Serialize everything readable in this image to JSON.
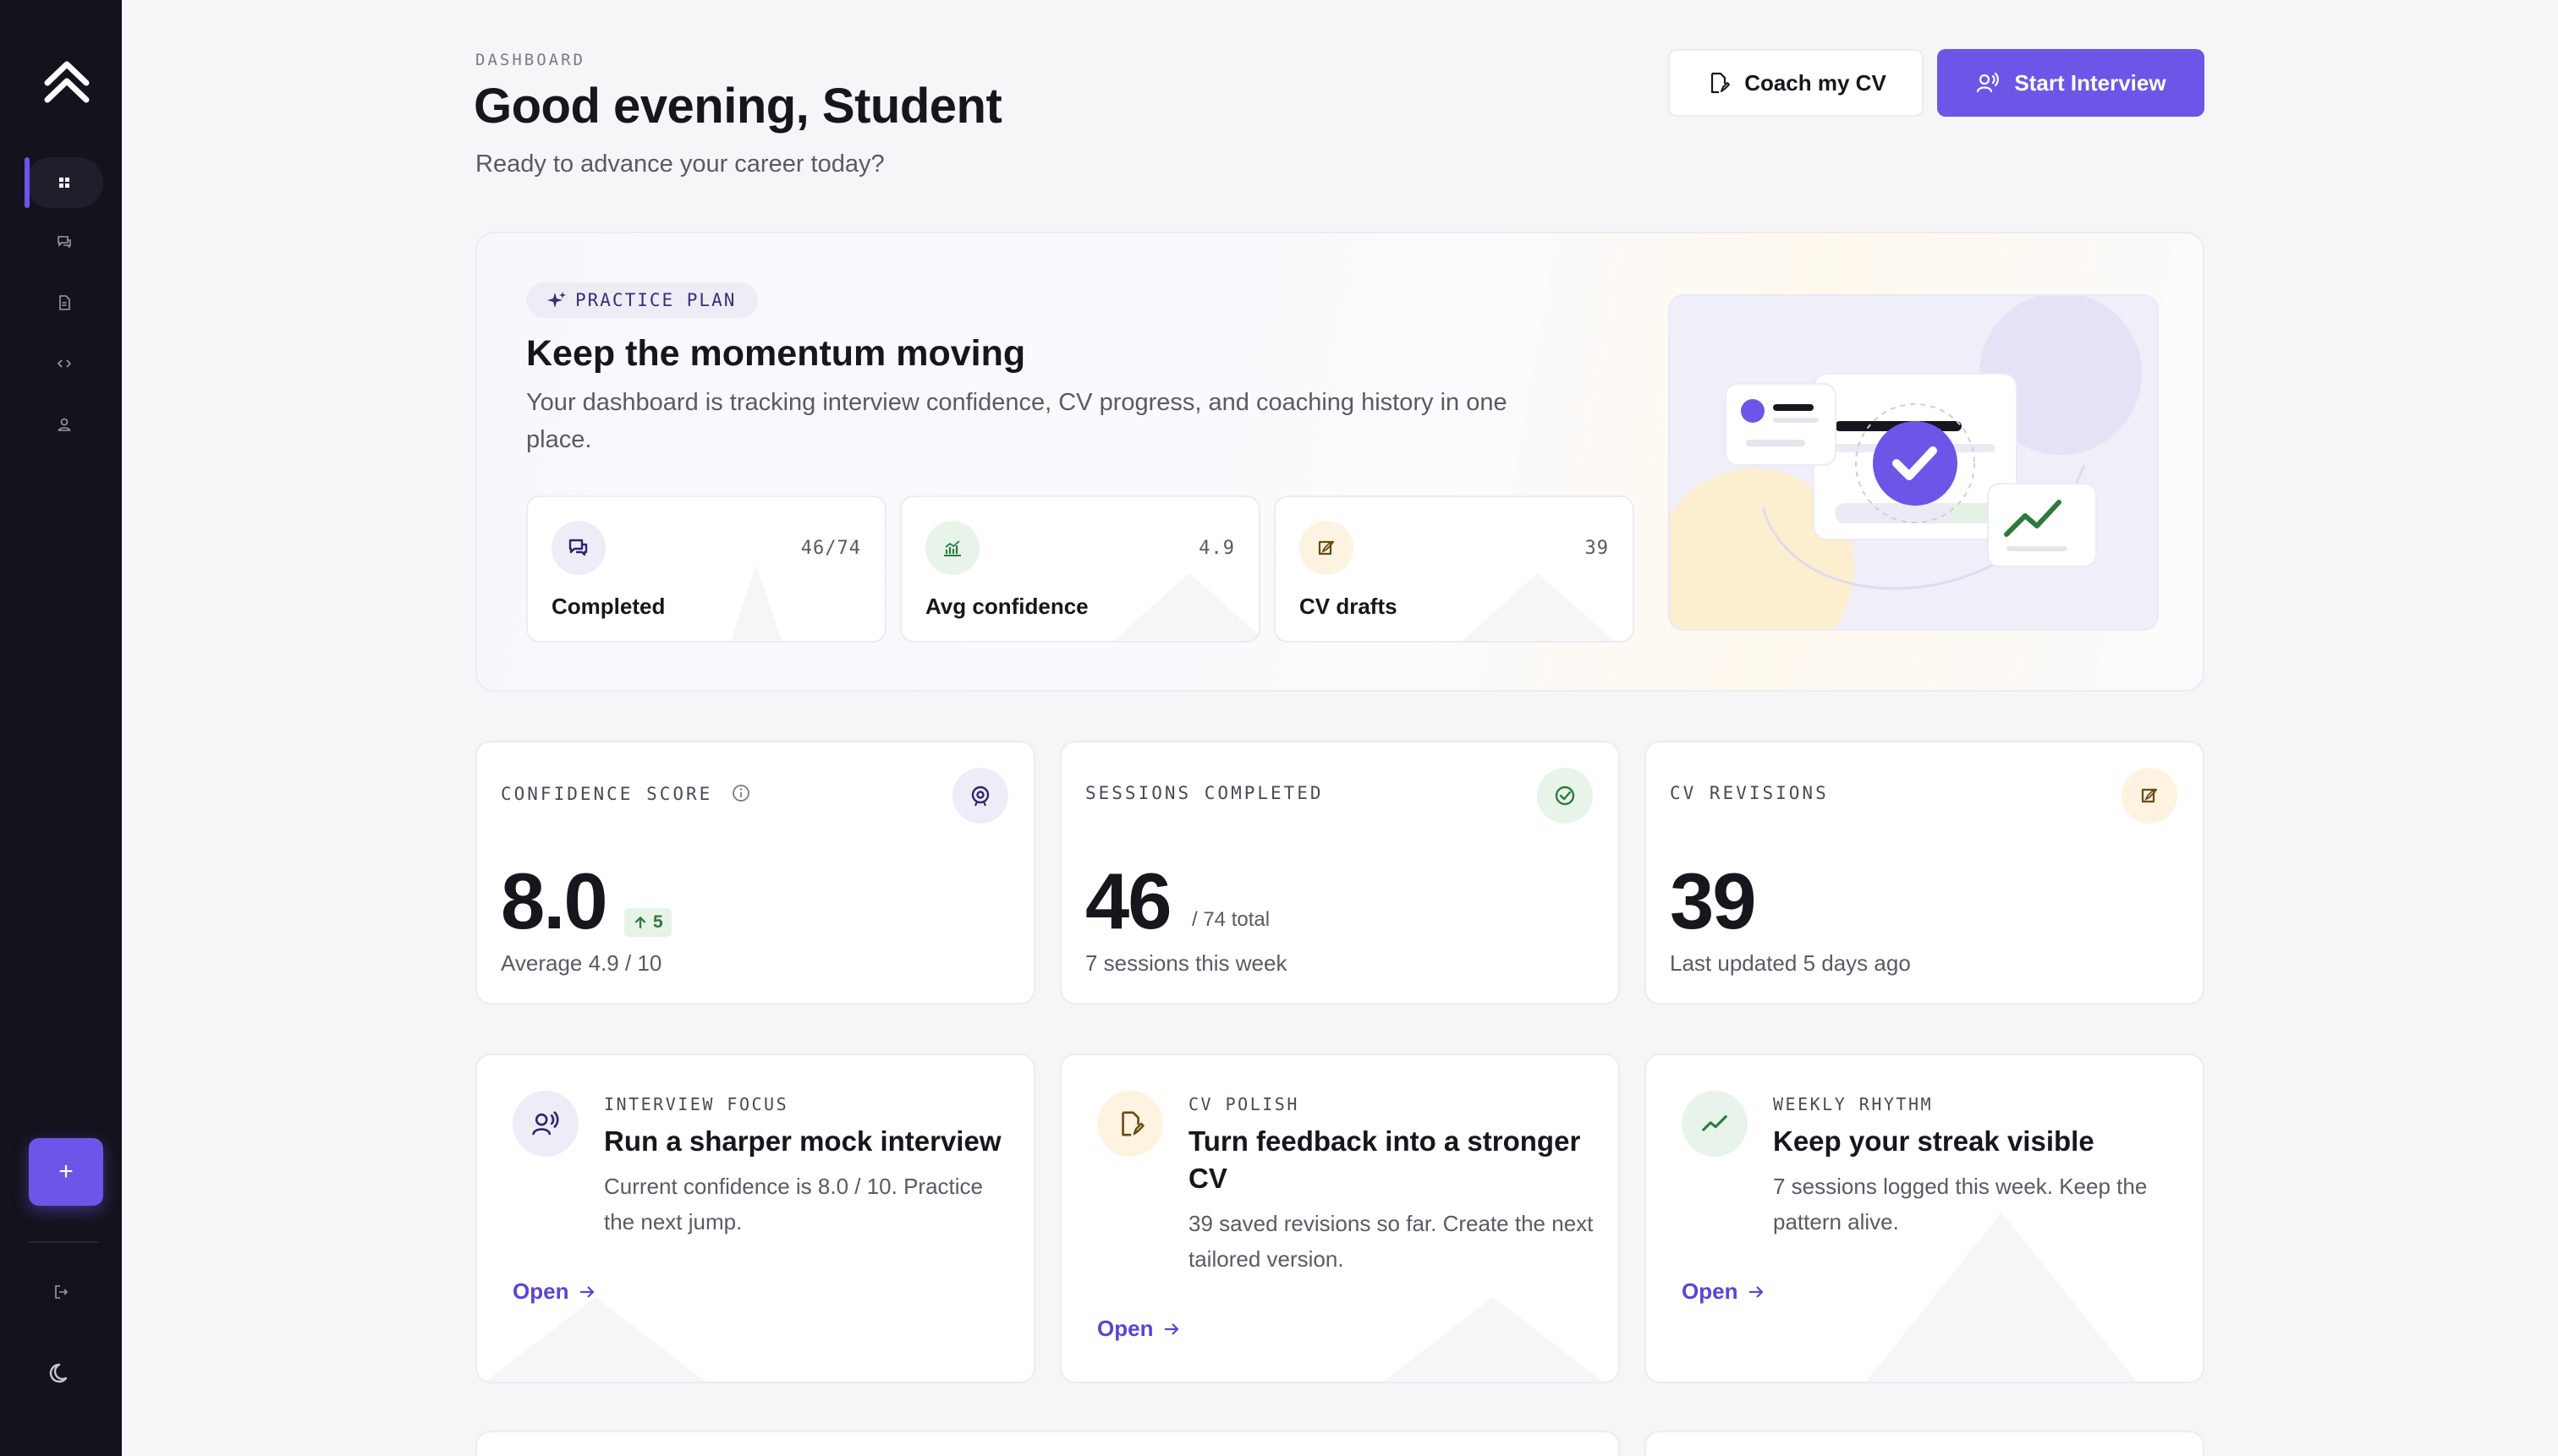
{
  "colors": {
    "accent": "#6c56e8",
    "sidebar_bg": "#13131d",
    "success": "#2d7a3c",
    "warning_bg": "#fdf3e0"
  },
  "sidebar": {
    "items": [
      {
        "name": "dashboard",
        "icon": "grid-icon",
        "active": true
      },
      {
        "name": "interviews",
        "icon": "chat-icon",
        "active": false
      },
      {
        "name": "cv",
        "icon": "document-icon",
        "active": false
      },
      {
        "name": "code",
        "icon": "code-icon",
        "active": false
      },
      {
        "name": "profile",
        "icon": "user-icon",
        "active": false
      }
    ],
    "plus_label": "+"
  },
  "header": {
    "eyebrow": "DASHBOARD",
    "title": "Good evening, Student",
    "subtitle": "Ready to advance your career today?",
    "coach_label": "Coach my CV",
    "start_label": "Start Interview"
  },
  "hero": {
    "pill": "PRACTICE PLAN",
    "title": "Keep the momentum moving",
    "description": "Your dashboard is tracking interview confidence, CV progress, and coaching history in one place.",
    "minis": [
      {
        "label": "Completed",
        "value": "46/74"
      },
      {
        "label": "Avg confidence",
        "value": "4.9"
      },
      {
        "label": "CV drafts",
        "value": "39"
      }
    ]
  },
  "stats": [
    {
      "eyebrow": "CONFIDENCE SCORE",
      "value": "8.0",
      "delta": "5",
      "footer": "Average 4.9 / 10"
    },
    {
      "eyebrow": "SESSIONS COMPLETED",
      "value": "46",
      "extra": "/ 74 total",
      "footer": "7 sessions this week"
    },
    {
      "eyebrow": "CV REVISIONS",
      "value": "39",
      "footer": "Last updated 5 days ago"
    }
  ],
  "focus": [
    {
      "eyebrow": "INTERVIEW FOCUS",
      "title": "Run a sharper mock interview",
      "description": "Current confidence is 8.0 / 10. Practice the next jump.",
      "link": "Open"
    },
    {
      "eyebrow": "CV POLISH",
      "title": "Turn feedback into a stronger CV",
      "description": "39 saved revisions so far. Create the next tailored version.",
      "link": "Open"
    },
    {
      "eyebrow": "WEEKLY RHYTHM",
      "title": "Keep your streak visible",
      "description": "7 sessions logged this week. Keep the pattern alive.",
      "link": "Open"
    }
  ]
}
